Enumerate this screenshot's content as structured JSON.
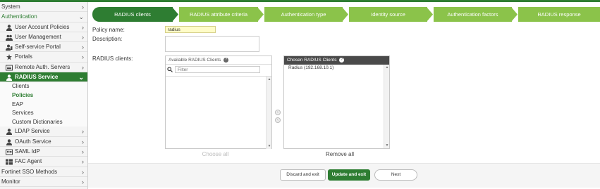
{
  "sidebar": {
    "system": "System",
    "authentication": "Authentication",
    "items": [
      {
        "label": "User Account Policies"
      },
      {
        "label": "User Management"
      },
      {
        "label": "Self-service Portal"
      },
      {
        "label": "Portals"
      },
      {
        "label": "Remote Auth. Servers"
      },
      {
        "label": "RADIUS Service"
      }
    ],
    "radius_sub": [
      "Clients",
      "Policies",
      "EAP",
      "Services",
      "Custom Dictionaries"
    ],
    "lower_items": [
      {
        "label": "LDAP Service"
      },
      {
        "label": "OAuth Service"
      },
      {
        "label": "SAML IdP"
      },
      {
        "label": "FAC Agent"
      }
    ],
    "fortinet_sso": "Fortinet SSO Methods",
    "monitor": "Monitor"
  },
  "steps": [
    "RADIUS clients",
    "RADIUS attribute criteria",
    "Authentication type",
    "Identity source",
    "Authentication factors",
    "RADIUS response"
  ],
  "form": {
    "policy_name_label": "Policy name:",
    "policy_name_value": "radius",
    "description_label": "Description:",
    "description_value": "",
    "radius_clients_label": "RADIUS clients:"
  },
  "available": {
    "header": "Available RADIUS Clients",
    "filter_placeholder": "Filter",
    "choose_all": "Choose all",
    "items": []
  },
  "chosen": {
    "header": "Chosen RADIUS Clients",
    "items": [
      "Radius (192.168.10.1)"
    ],
    "remove_all": "Remove all"
  },
  "footer": {
    "discard": "Discard and exit",
    "update": "Update and exit",
    "next": "Next"
  },
  "colors": {
    "accent": "#2e7d32",
    "step_inactive": "#8bc34a",
    "input_highlight": "#fffcc8"
  }
}
